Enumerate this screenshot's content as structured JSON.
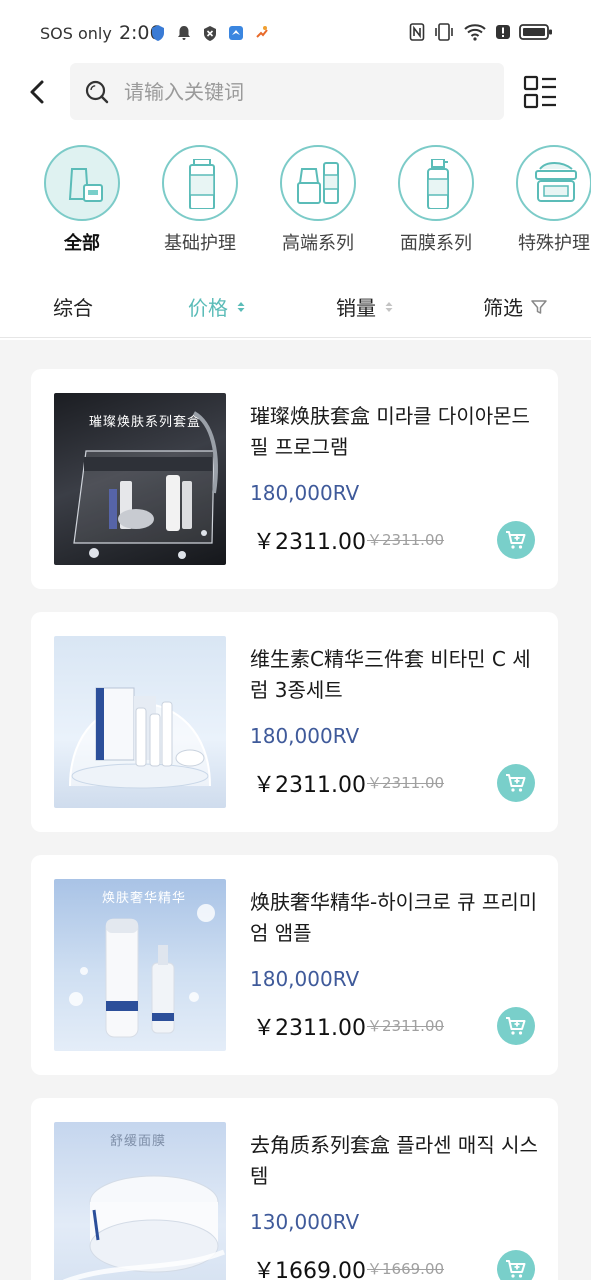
{
  "status": {
    "carrier": "SOS only",
    "time": "2:06"
  },
  "search": {
    "placeholder": "请输入关键词"
  },
  "categories": [
    {
      "label": "全部",
      "active": true,
      "icon": "all-products-icon"
    },
    {
      "label": "基础护理",
      "active": false,
      "icon": "basic-care-bottles-icon"
    },
    {
      "label": "高端系列",
      "active": false,
      "icon": "premium-series-icon"
    },
    {
      "label": "面膜系列",
      "active": false,
      "icon": "mask-spray-icon"
    },
    {
      "label": "特殊护理",
      "active": false,
      "icon": "cream-jar-icon"
    }
  ],
  "sort": {
    "comprehensive": "综合",
    "price": "价格",
    "sales": "销量",
    "filter": "筛选"
  },
  "products": [
    {
      "title": "璀璨焕肤套盒 미라클 다이아몬드 필 프로그램",
      "rv": "180,000RV",
      "price": "￥2311.00",
      "old_price": "￥2311.00",
      "thumb_text": "璀璨焕肤系列套盒"
    },
    {
      "title": "维生素C精华三件套 비타민 C 세럼 3종세트",
      "rv": "180,000RV",
      "price": "￥2311.00",
      "old_price": "￥2311.00",
      "thumb_text": ""
    },
    {
      "title": "焕肤奢华精华-하이크로 큐 프리미엄 앰플",
      "rv": "180,000RV",
      "price": "￥2311.00",
      "old_price": "￥2311.00",
      "thumb_text": "焕肤奢华精华"
    },
    {
      "title": "去角质系列套盒 플라센 매직 시스템",
      "rv": "130,000RV",
      "price": "￥1669.00",
      "old_price": "￥1669.00",
      "thumb_text": "舒缓面膜"
    }
  ],
  "colors": {
    "accent": "#79cfca",
    "rv": "#3f5a9a"
  }
}
